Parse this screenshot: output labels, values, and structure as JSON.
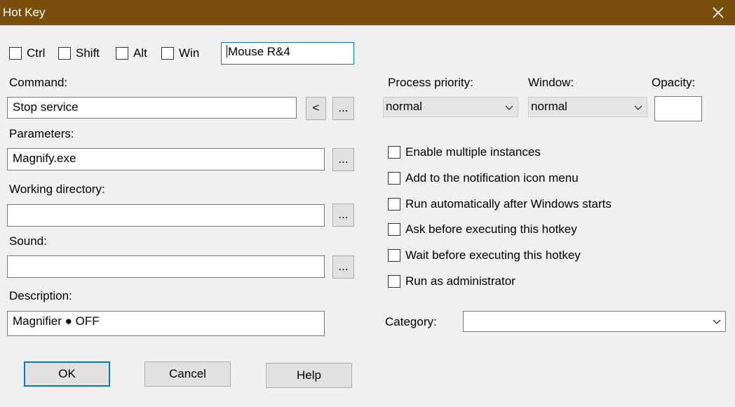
{
  "window": {
    "title": "Hot Key"
  },
  "modifiers": {
    "ctrl": "Ctrl",
    "shift": "Shift",
    "alt": "Alt",
    "win": "Win"
  },
  "hotkey": {
    "value": "Mouse R&4"
  },
  "command": {
    "label": "Command:",
    "value": "Stop service",
    "pick_btn": "<",
    "browse_btn": "..."
  },
  "parameters": {
    "label": "Parameters:",
    "value": "Magnify.exe",
    "browse_btn": "..."
  },
  "working_directory": {
    "label": "Working directory:",
    "value": "",
    "browse_btn": "..."
  },
  "sound": {
    "label": "Sound:",
    "value": "",
    "browse_btn": "..."
  },
  "description": {
    "label": "Description:",
    "value": "Magnifier ● OFF"
  },
  "process_priority": {
    "label": "Process priority:",
    "selected": "normal"
  },
  "window_mode": {
    "label": "Window:",
    "selected": "normal"
  },
  "opacity": {
    "label": "Opacity:",
    "value": ""
  },
  "options": {
    "multiple_instances": "Enable multiple instances",
    "notification_menu": "Add to the notification icon menu",
    "run_at_startup": "Run automatically after Windows starts",
    "ask_before": "Ask before executing this hotkey",
    "wait_before": "Wait before executing this hotkey",
    "run_as_admin": "Run as administrator"
  },
  "category": {
    "label": "Category:",
    "selected": ""
  },
  "buttons": {
    "ok": "OK",
    "cancel": "Cancel",
    "help": "Help"
  },
  "colors": {
    "titlebar": "#7a4f0b",
    "focus": "#0078d7"
  }
}
